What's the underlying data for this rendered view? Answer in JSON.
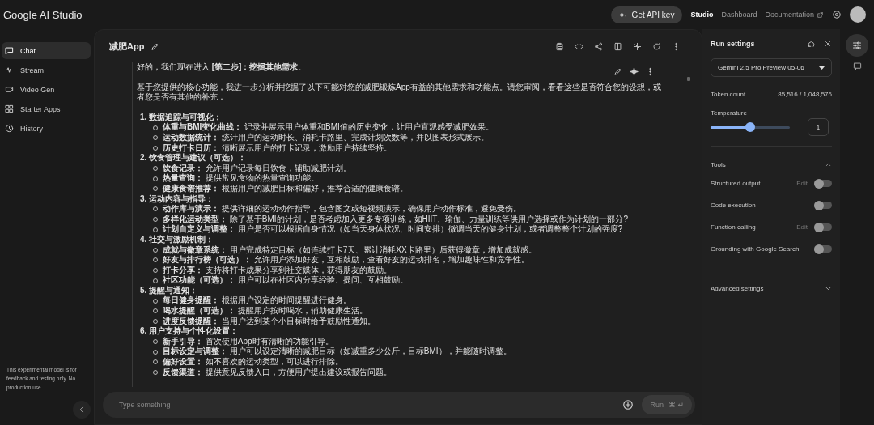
{
  "app": {
    "name": "Google AI Studio"
  },
  "header": {
    "api_key_button": "Get API key",
    "nav": [
      {
        "label": "Studio",
        "selected": true
      },
      {
        "label": "Dashboard",
        "selected": false
      },
      {
        "label": "Documentation",
        "selected": false
      }
    ]
  },
  "sidebar": {
    "items": [
      {
        "label": "Chat",
        "selected": true
      },
      {
        "label": "Stream",
        "selected": false
      },
      {
        "label": "Video Gen",
        "selected": false
      },
      {
        "label": "Starter Apps",
        "selected": false
      },
      {
        "label": "History",
        "selected": false
      }
    ],
    "footer_note": "This experimental model is for feedback and testing only. No production use."
  },
  "chat": {
    "title": "减肥App",
    "message": {
      "paragraphs": [
        "好的，我们现在进入 **[第二步]：挖掘其他需求**。",
        "基于您提供的核心功能，我进一步分析并挖掘了以下可能对您的减肥锻炼App有益的其他需求和功能点。请您审阅，看看这些是否符合您的设想，或者您是否有其他的补充："
      ],
      "sections": [
        {
          "heading": "1. 数据追踪与可视化：",
          "items": [
            "**体重与BMI变化曲线：** 记录并展示用户体重和BMI值的历史变化，让用户直观感受减肥效果。",
            "**运动数据统计：** 统计用户的运动时长、消耗卡路里、完成计划次数等，并以图表形式展示。",
            "**历史打卡日历：** 清晰展示用户的打卡记录，激励用户持续坚持。"
          ]
        },
        {
          "heading": "2. 饮食管理与建议（可选）：",
          "items": [
            "**饮食记录：** 允许用户记录每日饮食，辅助减肥计划。",
            "**热量查询：** 提供常见食物的热量查询功能。",
            "**健康食谱推荐：** 根据用户的减肥目标和偏好，推荐合适的健康食谱。"
          ]
        },
        {
          "heading": "3. 运动内容与指导：",
          "items": [
            "**动作库与演示：** 提供详细的运动动作指导，包含图文或短视频演示，确保用户动作标准，避免受伤。",
            "**多样化运动类型：** 除了基于BMI的计划，是否考虑加入更多专项训练，如HIIT、瑜伽、力量训练等供用户选择或作为计划的一部分?",
            "**计划自定义与调整：** 用户是否可以根据自身情况（如当天身体状况、时间安排）微调当天的健身计划，或者调整整个计划的强度?"
          ]
        },
        {
          "heading": "4. 社交与激励机制：",
          "items": [
            "**成就与徽章系统：** 用户完成特定目标（如连续打卡7天、累计消耗XX卡路里）后获得徽章，增加成就感。",
            "**好友与排行榜（可选）：** 允许用户添加好友，互相鼓励，查看好友的运动排名，增加趣味性和竞争性。",
            "**打卡分享：** 支持将打卡成果分享到社交媒体，获得朋友的鼓励。",
            "**社区功能（可选）：** 用户可以在社区内分享经验、提问、互相鼓励。"
          ]
        },
        {
          "heading": "5. 提醒与通知：",
          "items": [
            "**每日健身提醒：** 根据用户设定的时间提醒进行健身。",
            "**喝水提醒（可选）：** 提醒用户按时喝水，辅助健康生活。",
            "**进度反馈提醒：** 当用户达到某个小目标时给予鼓励性通知。"
          ]
        },
        {
          "heading": "6. 用户支持与个性化设置：",
          "items": [
            "**新手引导：** 首次使用App时有清晰的功能引导。",
            "**目标设定与调整：** 用户可以设定清晰的减肥目标（如减重多少公斤，目标BMI），并能随时调整。",
            "**偏好设置：** 如不喜欢的运动类型，可以进行排除。",
            "**反馈渠道：** 提供意见反馈入口，方便用户提出建议或报告问题。"
          ]
        }
      ]
    },
    "input": {
      "placeholder": "Type something"
    },
    "run_button": {
      "label": "Run",
      "shortcut": "⌘ ↵"
    }
  },
  "run_settings": {
    "title": "Run settings",
    "model": "Gemini 2.5 Pro Preview 05-06",
    "token_count": {
      "label": "Token count",
      "value": "85,516 / 1,048,576"
    },
    "temperature": {
      "label": "Temperature",
      "level": 0.5,
      "value": "1"
    },
    "tools": {
      "title": "Tools",
      "expanded": true,
      "items": [
        {
          "label": "Structured output",
          "edit": "Edit",
          "on": false
        },
        {
          "label": "Code execution",
          "on": false
        },
        {
          "label": "Function calling",
          "edit": "Edit",
          "on": false
        },
        {
          "label": "Grounding with Google Search",
          "on": false
        }
      ]
    },
    "advanced": {
      "label": "Advanced settings",
      "expanded": false
    }
  }
}
